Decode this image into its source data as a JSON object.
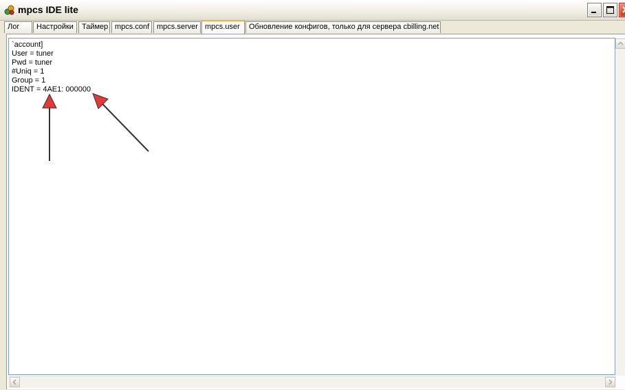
{
  "window": {
    "title": "mpcs IDE lite"
  },
  "tabs": [
    {
      "label": "Лог"
    },
    {
      "label": "Настройки"
    },
    {
      "label": "Таймер"
    },
    {
      "label": "mpcs.conf"
    },
    {
      "label": "mpcs.server"
    },
    {
      "label": "mpcs.user",
      "active": true
    },
    {
      "label": "Обновление конфигов, только для сервера cbilling.net"
    }
  ],
  "editor": {
    "lines": [
      "`account]",
      "User = tuner",
      "Pwd = tuner",
      "#Uniq = 1",
      "Group = 1",
      "IDENT = 4AE1: 000000"
    ]
  },
  "colors": {
    "annotation_arrow_fill": "#e53935",
    "annotation_arrow_line": "#333333",
    "active_tab_accent": "#f5b53a"
  }
}
